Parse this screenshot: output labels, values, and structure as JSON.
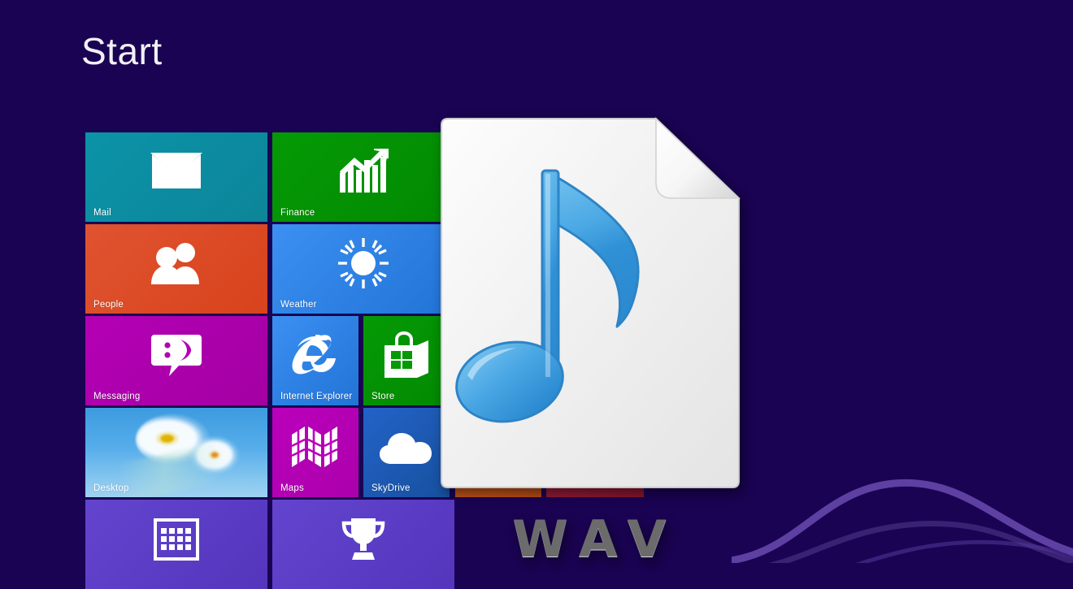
{
  "screen": {
    "title": "Start",
    "background_color": "#1a0352",
    "accent_swirl_color": "#5b3b9e"
  },
  "tiles": [
    {
      "name": "Mail",
      "label": "Mail",
      "color": "#0e8ca0",
      "color2": "#0b95ab",
      "icon": "envelope-icon",
      "size": "wide",
      "col": 0,
      "row": 0
    },
    {
      "name": "Finance",
      "label": "Finance",
      "color": "#049104",
      "color2": "#039503",
      "icon": "bar-chart-arrow-icon",
      "size": "wide",
      "col": 1,
      "row": 0
    },
    {
      "name": "People",
      "label": "People",
      "color": "#dc4a26",
      "color2": "#d9451f",
      "icon": "people-icon",
      "size": "wide",
      "col": 0,
      "row": 1
    },
    {
      "name": "Weather",
      "label": "Weather",
      "color": "#2a7fe0",
      "color2": "#3a8ef0",
      "icon": "sun-icon",
      "size": "wide",
      "col": 1,
      "row": 1
    },
    {
      "name": "Messaging",
      "label": "Messaging",
      "color": "#ac00ac",
      "color2": "#b400b4",
      "icon": "chat-bubble-icon",
      "size": "wide",
      "col": 0,
      "row": 2
    },
    {
      "name": "Internet Explorer",
      "label": "Internet Explorer",
      "color": "#2a7fe0",
      "color2": "#3a8ef0",
      "icon": "internet-explorer-icon",
      "size": "small",
      "col": 1,
      "row": 2
    },
    {
      "name": "Store",
      "label": "Store",
      "color": "#049104",
      "color2": "#039503",
      "icon": "shopping-bag-icon",
      "size": "small",
      "col": 2,
      "row": 2
    },
    {
      "name": "Desktop",
      "label": "Desktop",
      "color": "#56ade9",
      "color2": "#7cc4ef",
      "icon": "daisy-photo",
      "size": "wide",
      "col": 0,
      "row": 3
    },
    {
      "name": "Maps",
      "label": "Maps",
      "color": "#b400b4",
      "color2": "#bb00bb",
      "icon": "map-icon",
      "size": "small",
      "col": 1,
      "row": 3
    },
    {
      "name": "SkyDrive",
      "label": "SkyDrive",
      "color": "#1b56b8",
      "color2": "#2060c8",
      "icon": "cloud-icon",
      "size": "small",
      "col": 2,
      "row": 3
    },
    {
      "name": "Calendar",
      "label": "",
      "color": "#5b3ac4",
      "color2": "#6142cc",
      "icon": "calendar-icon",
      "size": "wide",
      "col": 0,
      "row": 4
    },
    {
      "name": "Games",
      "label": "",
      "color": "#5b3ac4",
      "color2": "#6142cc",
      "icon": "trophy-icon",
      "size": "wide",
      "col": 1,
      "row": 4
    }
  ],
  "hidden_tiles": [
    {
      "name": "orange-tile-strip",
      "color": "#bf5318"
    },
    {
      "name": "crimson-tile-strip",
      "color": "#8e1631"
    }
  ],
  "file_icon": {
    "name": "wav-file-icon",
    "extension_label": "WAV",
    "paper_color": "#efefef",
    "note_color": "#3e9ede",
    "label_color": "#6b6b6b"
  }
}
